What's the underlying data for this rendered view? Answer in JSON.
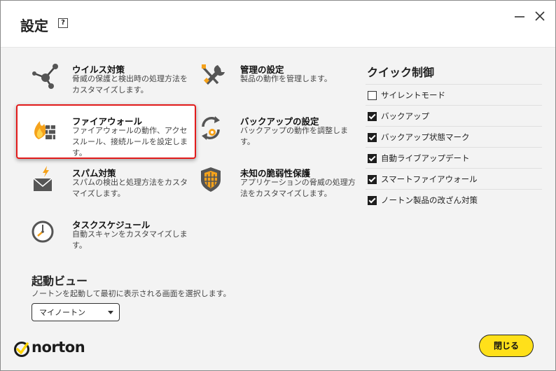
{
  "header": {
    "title": "設定",
    "help_label": "?"
  },
  "settings": {
    "virus": {
      "name": "ウイルス対策",
      "desc": "脅威の保護と検出時の処理方法をカスタマイズします。"
    },
    "firewall": {
      "name": "ファイアウォール",
      "desc": "ファイアウォールの動作、アクセスルール、接続ルールを設定します。"
    },
    "spam": {
      "name": "スパム対策",
      "desc": "スパムの検出と処理方法をカスタマイズします。"
    },
    "task": {
      "name": "タスクスケジュール",
      "desc": "自動スキャンをカスタマイズします。"
    },
    "admin": {
      "name": "管理の設定",
      "desc": "製品の動作を管理します。"
    },
    "backup": {
      "name": "バックアップの設定",
      "desc": "バックアップの動作を調整します。"
    },
    "vuln": {
      "name": "未知の脆弱性保護",
      "desc": "アプリケーションの脅威の処理方法をカスタマイズします。"
    }
  },
  "quick": {
    "title": "クイック制御",
    "items": [
      {
        "label": "サイレントモード",
        "checked": false
      },
      {
        "label": "バックアップ",
        "checked": true
      },
      {
        "label": "バックアップ状態マーク",
        "checked": true
      },
      {
        "label": "自動ライブアップデート",
        "checked": true
      },
      {
        "label": "スマートファイアウォール",
        "checked": true
      },
      {
        "label": "ノートン製品の改ざん対策",
        "checked": true
      }
    ]
  },
  "startup": {
    "title": "起動ビュー",
    "desc": "ノートンを起動して最初に表示される画面を選択します。",
    "selected": "マイノートン"
  },
  "footer": {
    "brand": "norton",
    "close_label": "閉じる"
  },
  "colors": {
    "accent_yellow": "#ffe01a",
    "highlight_red": "#e21b1b",
    "panel_bg": "#f3f3f3"
  }
}
